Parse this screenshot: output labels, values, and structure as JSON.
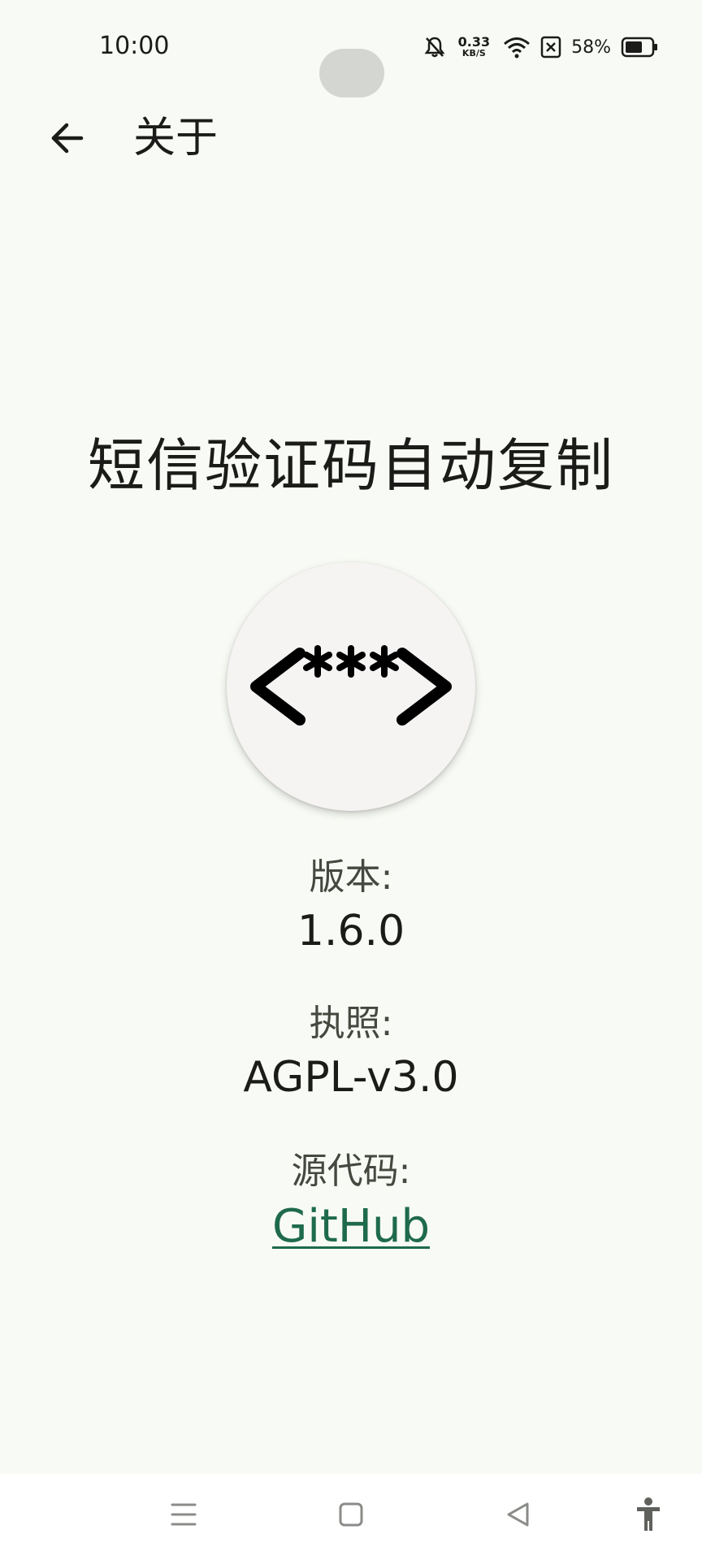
{
  "status_bar": {
    "time": "10:00",
    "net_speed_value": "0.33",
    "net_speed_unit": "KB/S",
    "battery_percent": "58%",
    "icons": [
      "bell-off-icon",
      "wifi-icon",
      "sim-error-icon",
      "battery-icon"
    ]
  },
  "app_bar": {
    "title": "关于",
    "back_icon": "arrow-left-icon"
  },
  "main": {
    "app_name": "短信验证码自动复制",
    "logo_icon": "code-asterisks-logo",
    "version_label": "版本:",
    "version_value": "1.6.0",
    "license_label": "执照:",
    "license_value": "AGPL-v3.0",
    "source_label": "源代码:",
    "source_link": "GitHub"
  },
  "nav_bar": {
    "icons": [
      "menu-icon",
      "home-square-icon",
      "back-triangle-icon",
      "accessibility-icon"
    ]
  },
  "colors": {
    "background": "#f8faf5",
    "link": "#1e6a4c",
    "text_primary": "#1b1c19",
    "text_secondary": "#44483f"
  }
}
